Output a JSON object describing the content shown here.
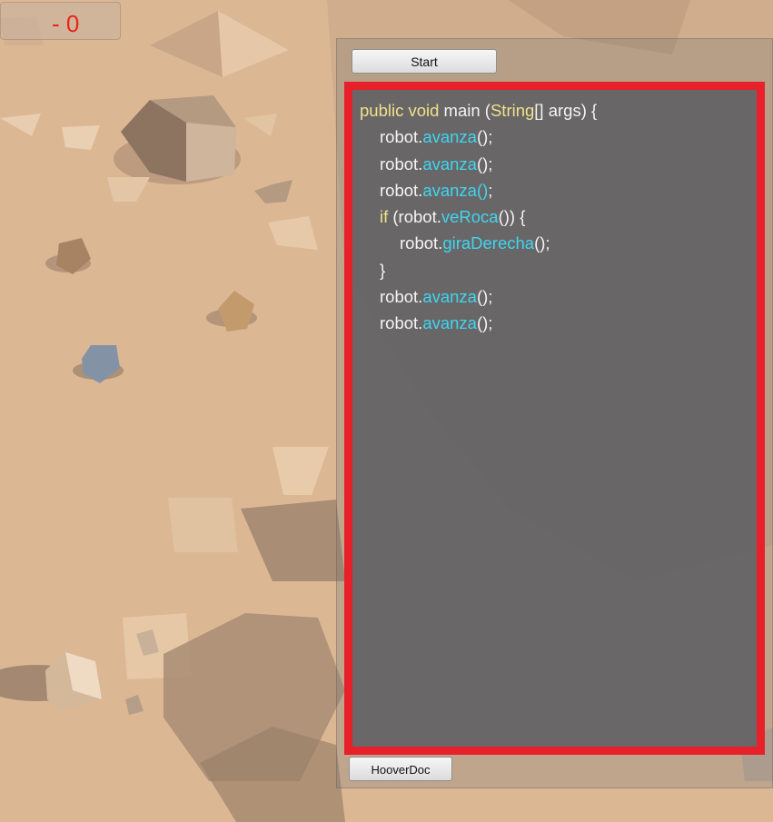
{
  "hud": {
    "score": "- 0"
  },
  "toolbar": {
    "start_label": "Start",
    "hoover_label": "HooverDoc"
  },
  "colors": {
    "highlight_border": "#e8202a",
    "keyword": "#f1e189",
    "method": "#3fd6f0",
    "score": "#e8241d"
  },
  "code": {
    "lines": [
      {
        "indent": 0,
        "tokens": [
          {
            "t": "public void",
            "c": "kw"
          },
          {
            "t": " main (",
            "c": ""
          },
          {
            "t": "String",
            "c": "kw"
          },
          {
            "t": "[] args) {",
            "c": ""
          }
        ]
      },
      {
        "indent": 1,
        "tokens": [
          {
            "t": "robot.",
            "c": ""
          },
          {
            "t": "avanza",
            "c": "fn"
          },
          {
            "t": "();",
            "c": ""
          }
        ]
      },
      {
        "indent": 1,
        "tokens": [
          {
            "t": "robot.",
            "c": ""
          },
          {
            "t": "avanza",
            "c": "fn"
          },
          {
            "t": "();",
            "c": ""
          }
        ]
      },
      {
        "indent": 1,
        "tokens": [
          {
            "t": "robot.",
            "c": ""
          },
          {
            "t": "avanza()",
            "c": "fn"
          },
          {
            "t": ";",
            "c": ""
          }
        ]
      },
      {
        "indent": 1,
        "tokens": [
          {
            "t": "if",
            "c": "kw"
          },
          {
            "t": " (robot.",
            "c": ""
          },
          {
            "t": "veRoca",
            "c": "fn"
          },
          {
            "t": "()) {",
            "c": ""
          }
        ]
      },
      {
        "indent": 2,
        "tokens": [
          {
            "t": "robot.",
            "c": ""
          },
          {
            "t": "giraDerecha",
            "c": "fn"
          },
          {
            "t": "();",
            "c": ""
          }
        ]
      },
      {
        "indent": 1,
        "tokens": [
          {
            "t": "}",
            "c": ""
          }
        ]
      },
      {
        "indent": 1,
        "tokens": [
          {
            "t": "robot.",
            "c": ""
          },
          {
            "t": "avanza",
            "c": "fn"
          },
          {
            "t": "();",
            "c": ""
          }
        ]
      },
      {
        "indent": 1,
        "tokens": [
          {
            "t": "robot.",
            "c": ""
          },
          {
            "t": "avanza",
            "c": "fn"
          },
          {
            "t": "();",
            "c": ""
          }
        ]
      }
    ]
  }
}
